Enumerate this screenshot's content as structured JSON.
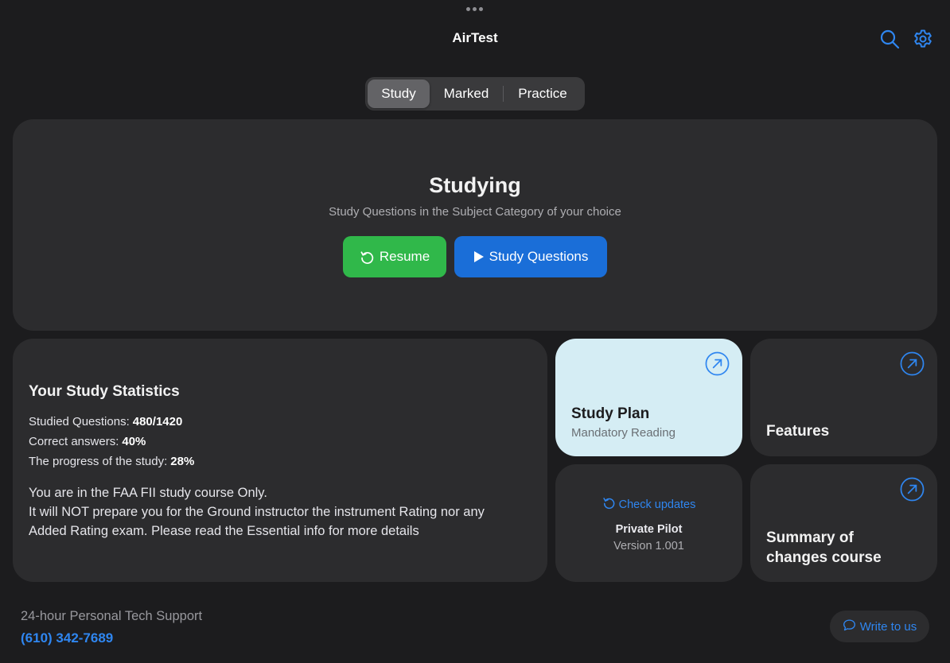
{
  "app": {
    "title": "AirTest"
  },
  "header": {
    "search_icon": "search-icon",
    "settings_icon": "gear-icon"
  },
  "tabs": [
    {
      "label": "Study",
      "active": true
    },
    {
      "label": "Marked",
      "active": false
    },
    {
      "label": "Practice",
      "active": false
    }
  ],
  "hero": {
    "title": "Studying",
    "subtitle": "Study Questions in the Subject Category of your choice",
    "resume_label": "Resume",
    "study_label": "Study Questions"
  },
  "stats": {
    "title": "Your Study Statistics",
    "rows": [
      {
        "label": "Studied Questions:",
        "value": "480/1420"
      },
      {
        "label": "Correct answers:",
        "value": "40%"
      },
      {
        "label": "The progress of the study:",
        "value": "28%"
      }
    ],
    "note": [
      "You are in the FAA FII study course Only.",
      "It will NOT prepare you for the Ground instructor the instrument Rating nor any",
      "Added Rating exam. Please read the Essential info for more details"
    ]
  },
  "tiles": {
    "study_plan": {
      "title": "Study Plan",
      "subtitle": "Mandatory Reading"
    },
    "features": {
      "title": "Features"
    },
    "updates": {
      "check_label": "Check updates",
      "course": "Private Pilot",
      "version": "Version 1.001"
    },
    "summary": {
      "title": "Summary of changes course"
    }
  },
  "footer": {
    "support_label": "24-hour Personal Tech Support",
    "phone": "(610) 342-7689",
    "write_label": "Write to us"
  },
  "colors": {
    "background": "#1c1c1e",
    "card": "#2c2c2e",
    "accent_blue": "#2f86f0",
    "resume_green": "#30b84a",
    "study_blue": "#1a6ed8",
    "plan_tile": "#d5edf4"
  }
}
